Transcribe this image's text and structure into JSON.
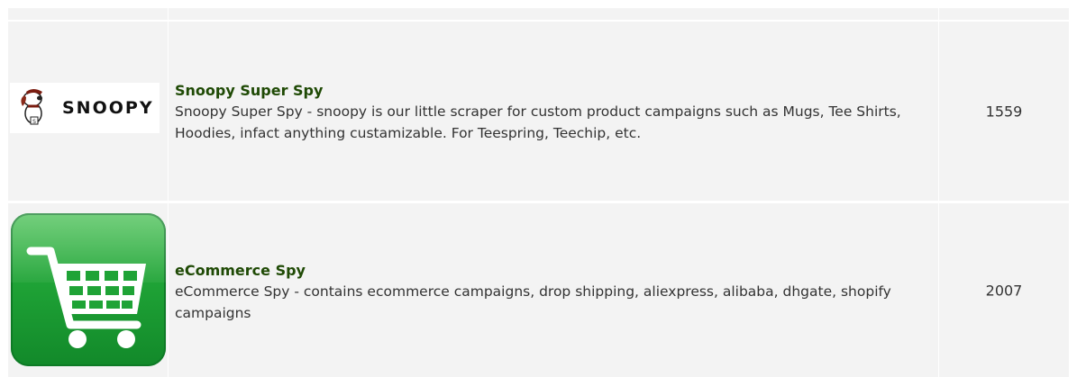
{
  "rows": [
    {
      "logo_text": "SNOOPY",
      "title": "Snoopy Super Spy",
      "description": "Snoopy Super Spy - snoopy is our little scraper for custom product campaigns such as Mugs, Tee Shirts, Hoodies, infact anything custamizable. For Teespring, Teechip, etc.",
      "count": "1559"
    },
    {
      "logo_icon": "shopping-cart-icon",
      "title": "eCommerce Spy",
      "description": "eCommerce Spy - contains ecommerce campaigns, drop shipping, aliexpress, alibaba, dhgate, shopify campaigns",
      "count": "2007"
    }
  ],
  "colors": {
    "cell_bg": "#f3f3f3",
    "title": "#1f4a05",
    "cart_green": "#1fa336"
  }
}
